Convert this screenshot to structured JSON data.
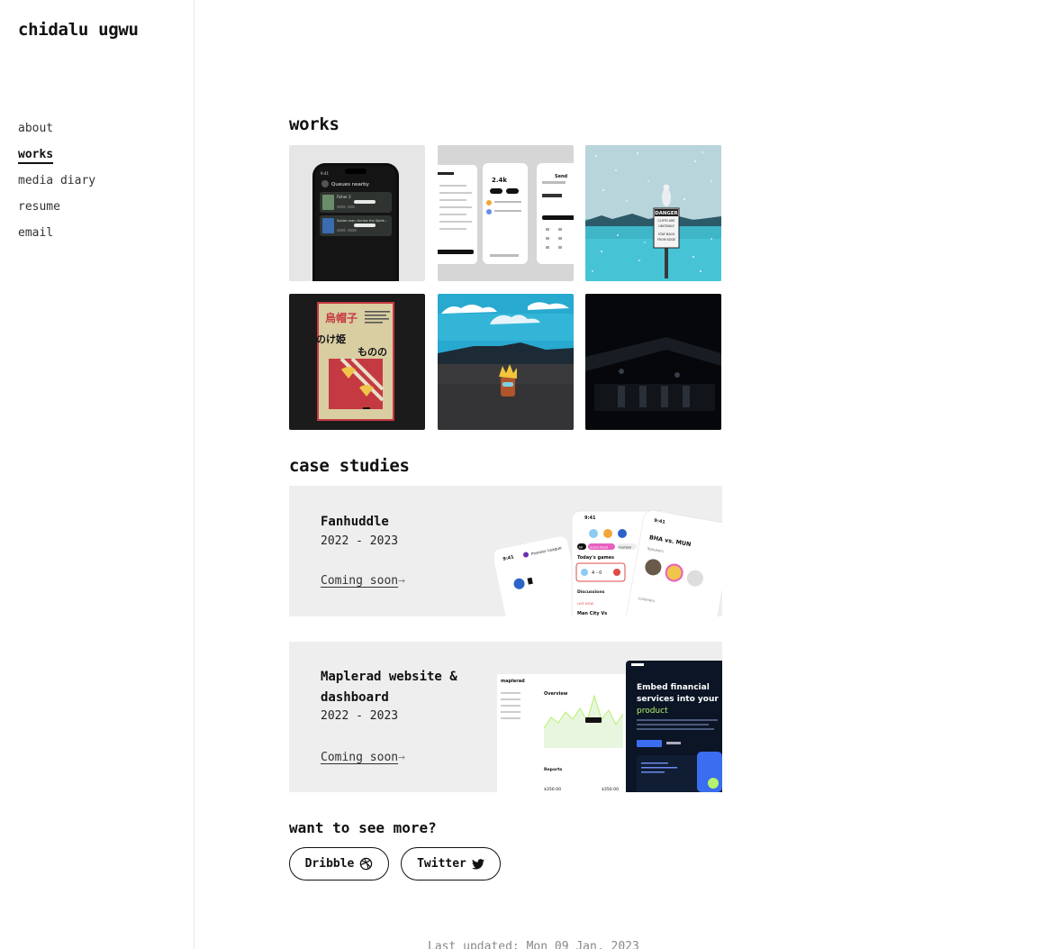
{
  "brand": {
    "name": "chidalu ugwu"
  },
  "nav": {
    "items": [
      {
        "label": "about",
        "active": false
      },
      {
        "label": "works",
        "active": true
      },
      {
        "label": "media diary",
        "active": false
      },
      {
        "label": "resume",
        "active": false
      },
      {
        "label": "email",
        "active": false
      }
    ]
  },
  "works": {
    "heading": "works",
    "tiles": {
      "queues": {
        "title": "Queues nearby",
        "item1": "Fisher 2",
        "item2": "Spider-man: Across the Spide...",
        "status": "9:41"
      },
      "wallet": {
        "balance": "2.4k",
        "section": "Send"
      },
      "sign": {
        "line1": "DANGER",
        "line2": "CLIFFS ARE",
        "line3": "UNSTABLE",
        "line4": "STAY BACK",
        "line5": "FROM EDGE"
      },
      "poster": {
        "jp1": "烏帽子",
        "jp2": "のけ姫",
        "jp3": "ものの"
      }
    }
  },
  "case_studies": {
    "heading": "case studies",
    "items": [
      {
        "title": "Fanhuddle",
        "years": "2022 - 2023",
        "link": "Coming soon",
        "art": {
          "time": "9:41",
          "league": "Premier League",
          "games": "Today's games",
          "score": "4 - 0",
          "chip_all": "All",
          "chip_sub": "Subscribed",
          "chip_football": "Football",
          "discussions": "Discussions",
          "live": "LIVE NOW",
          "match": "Man City Vs",
          "versus": "BHA vs. MUN",
          "speakers": "Speakers",
          "listeners": "Listeners"
        }
      },
      {
        "title": "Maplerad website & dashboard",
        "years": "2022 - 2023",
        "link": "Coming soon",
        "art": {
          "logo": "maplerad",
          "overview": "Overview",
          "reports": "Reports",
          "amount1": "$350.00",
          "amount2": "$350.00",
          "hero1": "Embed financial",
          "hero2": "services into your",
          "hero3": "product"
        }
      }
    ]
  },
  "more": {
    "heading": "want to see more?",
    "dribbble": "Dribble",
    "twitter": "Twitter"
  },
  "footer": {
    "text": "Last updated: Mon 09 Jan, 2023"
  },
  "colors": {
    "text": "#111111",
    "muted": "#888888",
    "card": "#eeeeee",
    "accent": "#b6f26b"
  }
}
